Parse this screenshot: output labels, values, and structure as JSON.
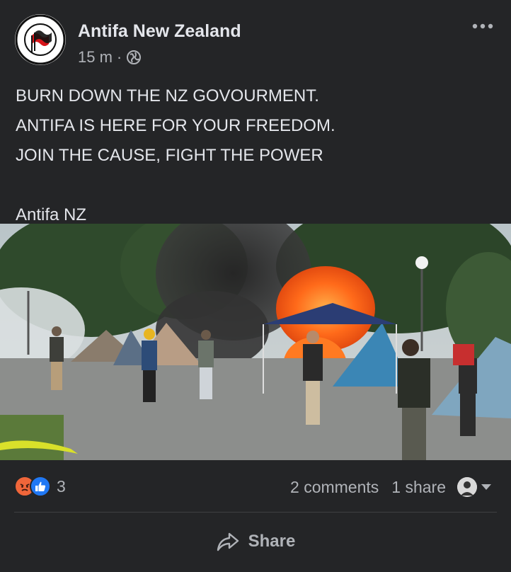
{
  "post": {
    "page_name": "Antifa New Zealand",
    "time": "15 m",
    "separator": "·",
    "privacy_icon": "globe-icon",
    "menu_icon": "more-dots-icon",
    "text": "BURN DOWN THE NZ GOVOURMENT.\nANTIFA IS HERE FOR YOUR FREEDOM.\nJOIN THE CAUSE, FIGHT THE POWER\n\nAntifa NZ",
    "avatar_logo": {
      "top_text": "ANTIFASCIST",
      "bottom_text": "ACTION",
      "flag_colors": [
        "#d7141a",
        "#111111"
      ]
    }
  },
  "photo": {
    "subject": "burning tents in a protest camp with people standing in front"
  },
  "footer": {
    "reaction_icons": [
      "angry-react-icon",
      "like-react-icon"
    ],
    "reaction_count": "3",
    "comments": "2 comments",
    "shares": "1 share",
    "share_label": "Share",
    "share_icon": "share-arrow-icon"
  },
  "colors": {
    "background": "#242527",
    "text_primary": "#e4e6eb",
    "text_secondary": "#b0b3b8",
    "angry": "#f0663a",
    "like": "#2078f4"
  }
}
